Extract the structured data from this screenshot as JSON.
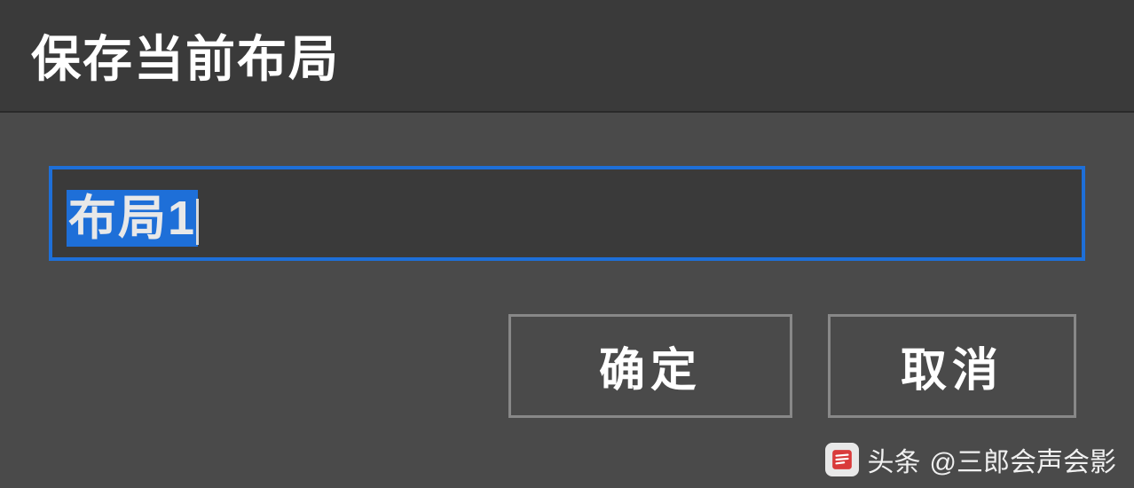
{
  "dialog": {
    "title": "保存当前布局",
    "input_value": "布局1",
    "ok_label": "确定",
    "cancel_label": "取消"
  },
  "watermark": {
    "prefix": "头条",
    "handle": "@三郎会声会影"
  }
}
